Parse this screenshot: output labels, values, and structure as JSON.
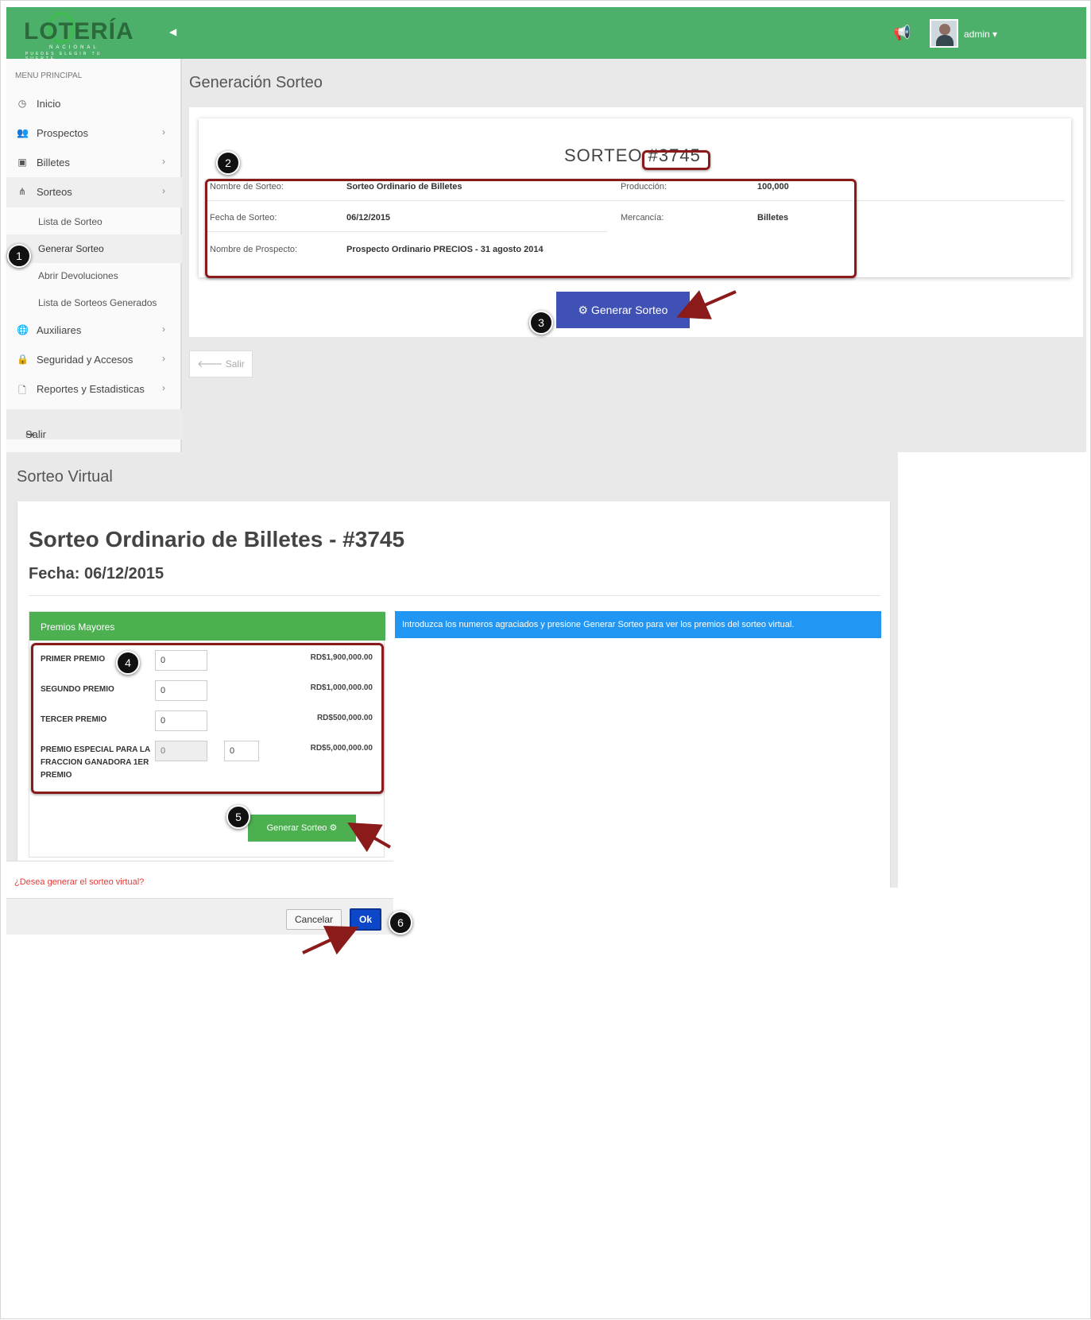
{
  "header": {
    "logo_word": "LOTERÍA",
    "logo_sub": "NACIONAL",
    "logo_tagline": "PUEDES ELEGIR TU SUERTE",
    "user": "admin"
  },
  "sidebar": {
    "section": "MENU PRINCIPAL",
    "items": [
      {
        "label": "Inicio"
      },
      {
        "label": "Prospectos"
      },
      {
        "label": "Billetes"
      },
      {
        "label": "Sorteos"
      },
      {
        "label": "Auxiliares"
      },
      {
        "label": "Seguridad y Accesos"
      },
      {
        "label": "Reportes y Estadisticas"
      }
    ],
    "sorteos_sub": [
      {
        "label": "Lista de Sorteo"
      },
      {
        "label": "Generar Sorteo"
      },
      {
        "label": "Abrir Devoluciones"
      },
      {
        "label": "Lista de Sorteos Generados"
      }
    ],
    "logout": "Salir"
  },
  "generacion": {
    "page_title": "Generación Sorteo",
    "sorteo_label": "SORTEO",
    "sorteo_number": "#3745",
    "fields": {
      "nombre_sorteo_label": "Nombre de Sorteo:",
      "nombre_sorteo_value": "Sorteo Ordinario de Billetes",
      "produccion_label": "Producción:",
      "produccion_value": "100,000",
      "fecha_label": "Fecha de Sorteo:",
      "fecha_value": "06/12/2015",
      "mercancia_label": "Mercancía:",
      "mercancia_value": "Billetes",
      "prospecto_label": "Nombre de Prospecto:",
      "prospecto_value": "Prospecto Ordinario PRECIOS - 31 agosto 2014"
    },
    "generate_button": "Generar Sorteo",
    "exit_button": "Salir"
  },
  "virtual": {
    "page_title": "Sorteo Virtual",
    "title": "Sorteo Ordinario de Billetes - #3745",
    "fecha": "Fecha: 06/12/2015",
    "premios_header": "Premios Mayores",
    "prizes": [
      {
        "label": "PRIMER PREMIO",
        "value": "0",
        "amount": "RD$1,900,000.00"
      },
      {
        "label": "SEGUNDO PREMIO",
        "value": "0",
        "amount": "RD$1,000,000.00"
      },
      {
        "label": "TERCER PREMIO",
        "value": "0",
        "amount": "RD$500,000.00"
      },
      {
        "label": "PREMIO ESPECIAL PARA LA FRACCION GANADORA 1ER PREMIO",
        "value": "0",
        "value2": "0",
        "amount": "RD$5,000,000.00"
      }
    ],
    "generate_button": "Generar Sorteo",
    "info_message": "Introduzca los numeros agraciados y presione Generar Sorteo para ver los premios del sorteo virtual."
  },
  "dialog": {
    "question": "¿Desea generar el sorteo virtual?",
    "cancel": "Cancelar",
    "ok": "Ok"
  },
  "steps": [
    "1",
    "2",
    "3",
    "4",
    "5",
    "6"
  ],
  "colors": {
    "topbar": "#4caf6a",
    "primary_button": "#3f51b5",
    "green_button": "#4caf50",
    "info": "#2196f3",
    "highlight": "#8b1a1a",
    "ok_button": "#0d47c9"
  }
}
